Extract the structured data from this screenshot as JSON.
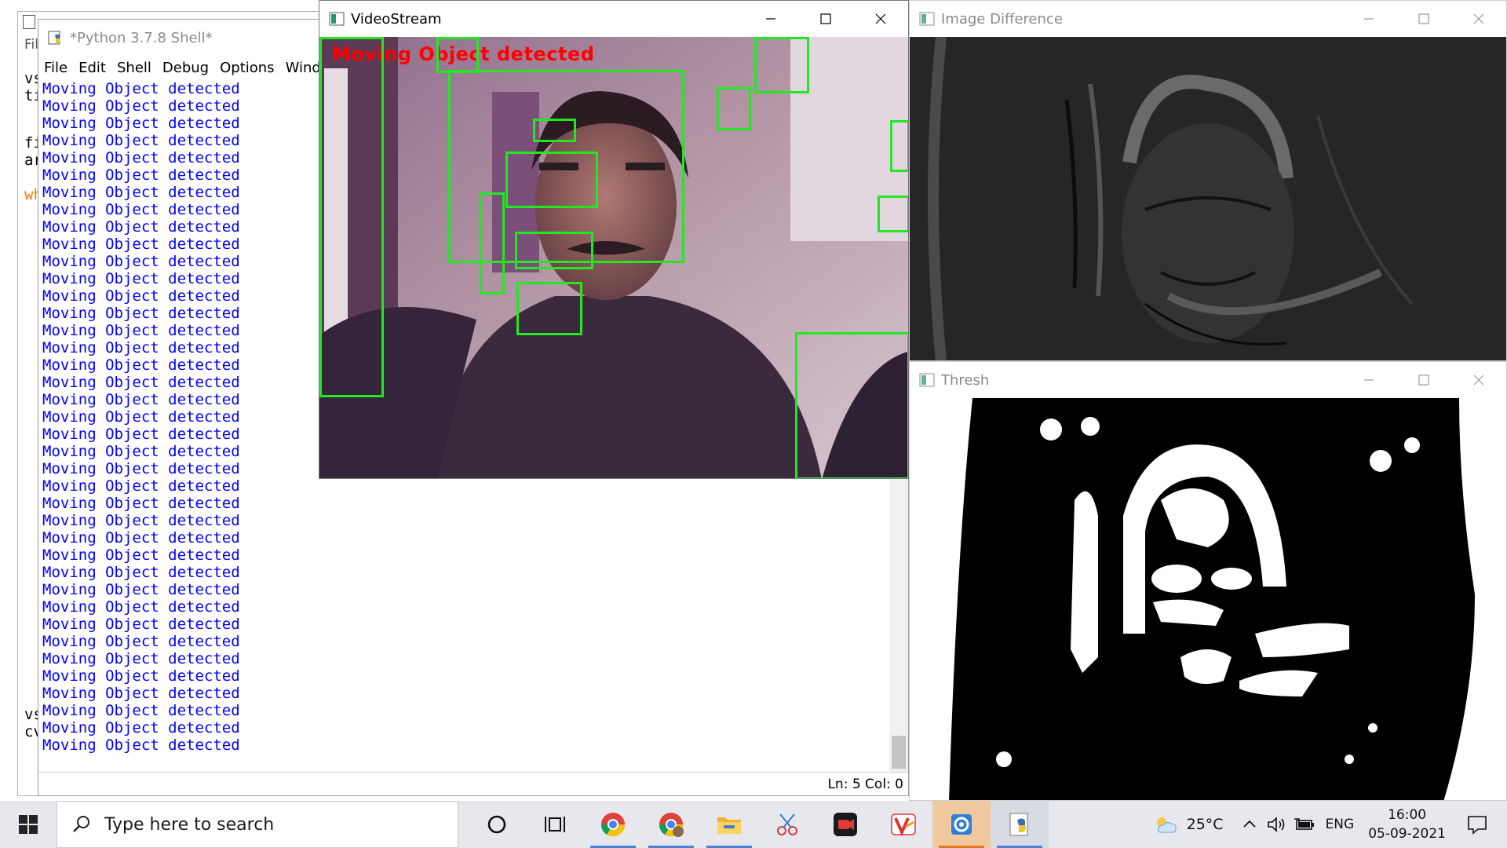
{
  "background_editor": {
    "menu_fragment": "Fil",
    "code_fragments": [
      "vs",
      "ti",
      "fi",
      "ar",
      "wh",
      "vs",
      "cv"
    ]
  },
  "shell": {
    "title": "*Python 3.7.8 Shell*",
    "menu": [
      "File",
      "Edit",
      "Shell",
      "Debug",
      "Options",
      "Window"
    ],
    "output_lines": [
      "Moving Object detected",
      "Moving Object detected",
      "Moving Object detected",
      "Moving Object detected",
      "Moving Object detected",
      "Moving Object detected",
      "Moving Object detected",
      "Moving Object detected",
      "Moving Object detected",
      "Moving Object detected",
      "Moving Object detected",
      "Moving Object detected",
      "Moving Object detected",
      "Moving Object detected",
      "Moving Object detected",
      "Moving Object detected",
      "Moving Object detected",
      "Moving Object detected",
      "Moving Object detected",
      "Moving Object detected",
      "Moving Object detected",
      "Moving Object detected",
      "Moving Object detected",
      "Moving Object detected",
      "Moving Object detected",
      "Moving Object detected",
      "Moving Object detected",
      "Moving Object detected",
      "Moving Object detected",
      "Moving Object detected",
      "Moving Object detected",
      "Moving Object detected",
      "Moving Object detected",
      "Moving Object detected",
      "Moving Object detected",
      "Moving Object detected",
      "Moving Object detected",
      "Moving Object detected",
      "Moving Object detected"
    ],
    "status": "Ln: 5  Col: 0",
    "text_color": "#0000ff"
  },
  "videostream": {
    "title": "VideoStream",
    "overlay_text": "Moving Object detected",
    "overlay_color": "#ff0000",
    "box_color": "#22e822"
  },
  "image_difference": {
    "title": "Image Difference"
  },
  "thresh": {
    "title": "Thresh"
  },
  "taskbar": {
    "search_placeholder": "Type here to search",
    "pinned_icons": [
      "cortana-icon",
      "task-view-icon",
      "chrome-icon",
      "chrome-profile-icon",
      "file-explorer-icon",
      "snipping-icon",
      "screen-recorder-icon",
      "vivaldi-icon",
      "camera-app-icon",
      "python-idle-icon"
    ],
    "weather": "25°C",
    "language": "ENG",
    "time": "16:00",
    "date": "05-09-2021"
  }
}
